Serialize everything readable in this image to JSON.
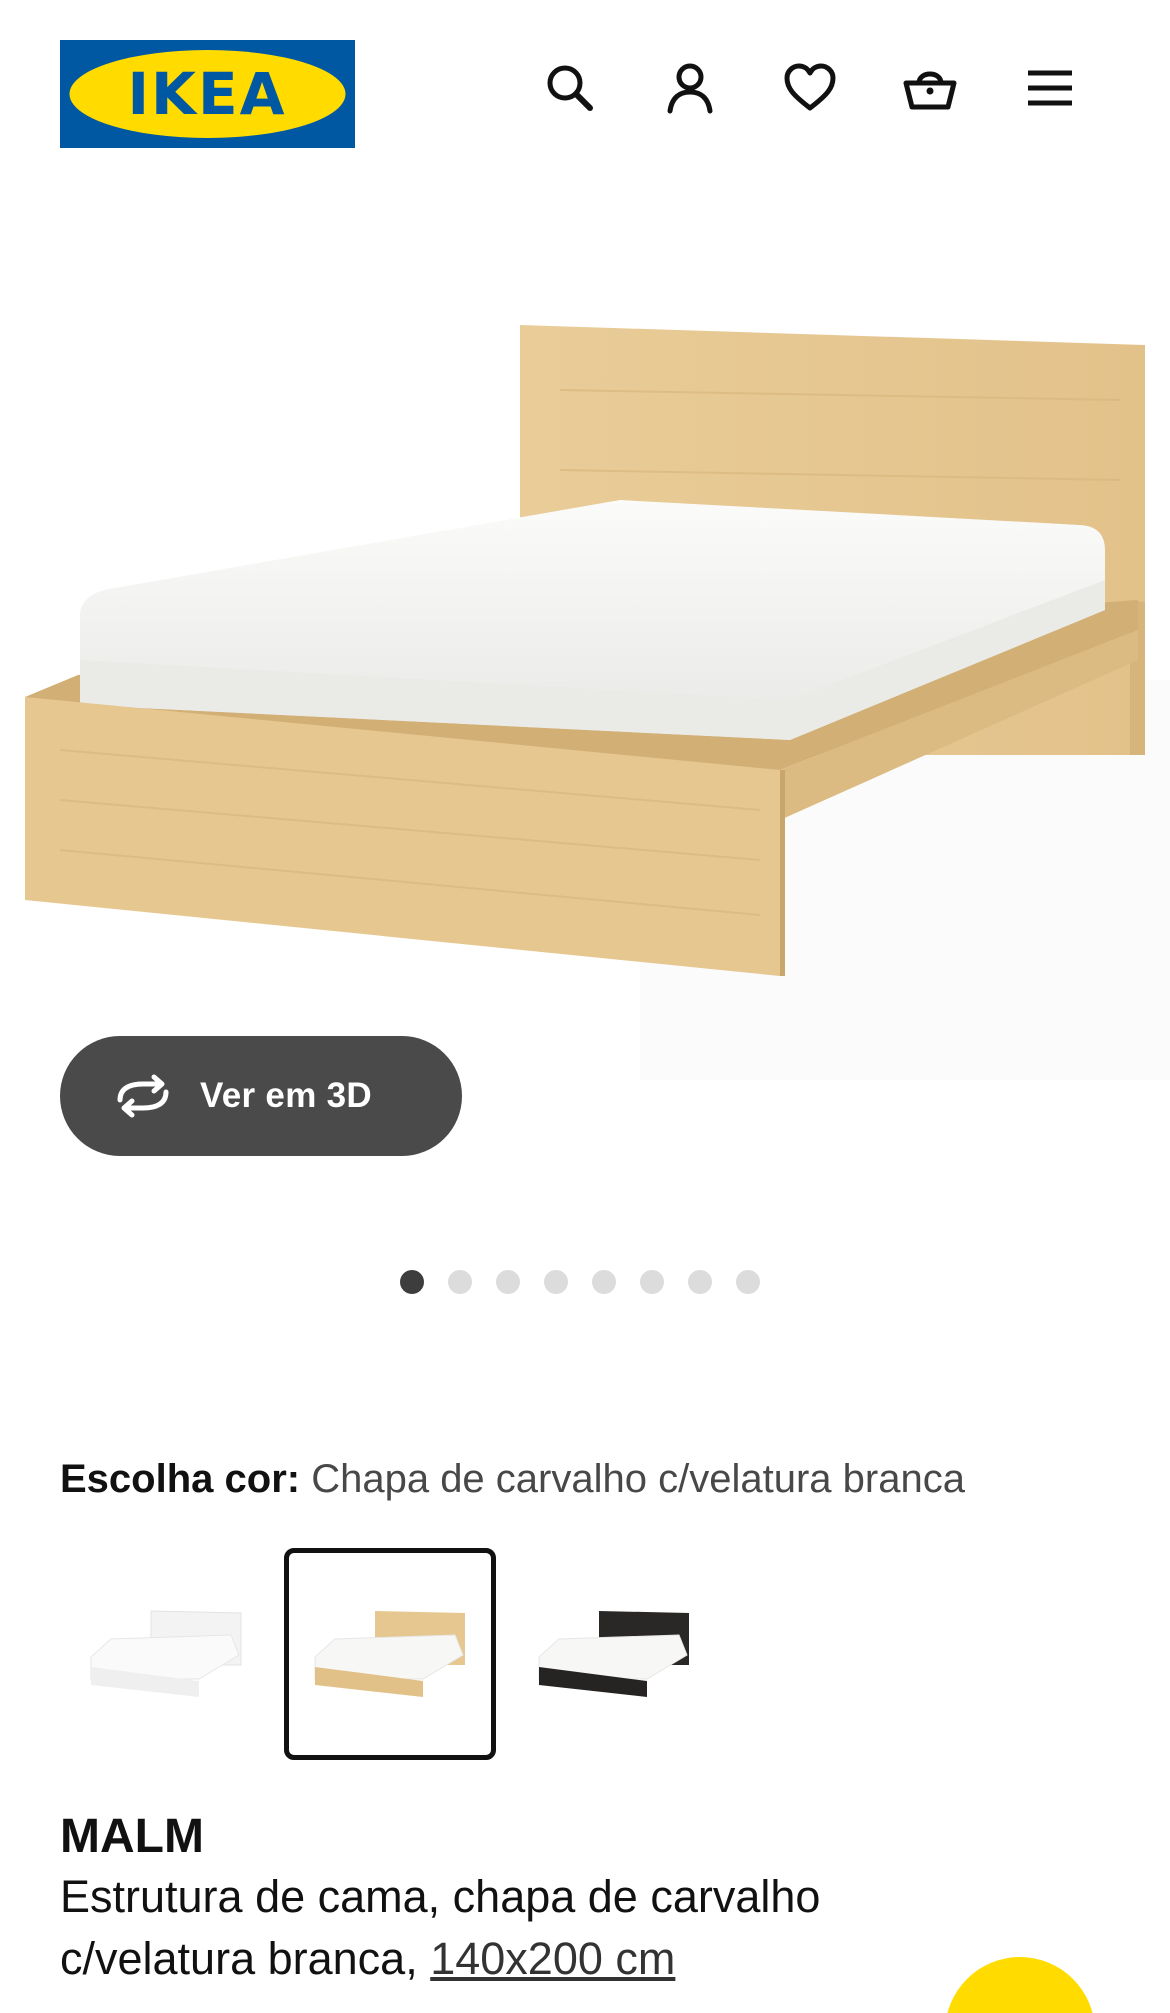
{
  "header": {
    "logo_text": "IKEA",
    "icons": [
      "search-icon",
      "user-icon",
      "heart-icon",
      "basket-icon",
      "menu-icon"
    ]
  },
  "gallery": {
    "view3d_label": "Ver em 3D",
    "dot_count": 8,
    "active_index": 0
  },
  "color_picker": {
    "label": "Escolha cor:",
    "selected_value": "Chapa de carvalho c/velatura branca",
    "options": [
      {
        "name": "white",
        "selected": false
      },
      {
        "name": "oak-white-stained",
        "selected": true
      },
      {
        "name": "black-brown",
        "selected": false
      }
    ]
  },
  "product": {
    "name": "MALM",
    "description": "Estrutura de cama, chapa de carvalho c/velatura branca,",
    "size": "140x200 cm"
  },
  "colors": {
    "ikea_blue": "#0058a3",
    "ikea_yellow": "#ffdb00",
    "button_dark": "#4a4a4a",
    "dot_active": "#3d3d3d",
    "dot_inactive": "#dcdcdc"
  }
}
